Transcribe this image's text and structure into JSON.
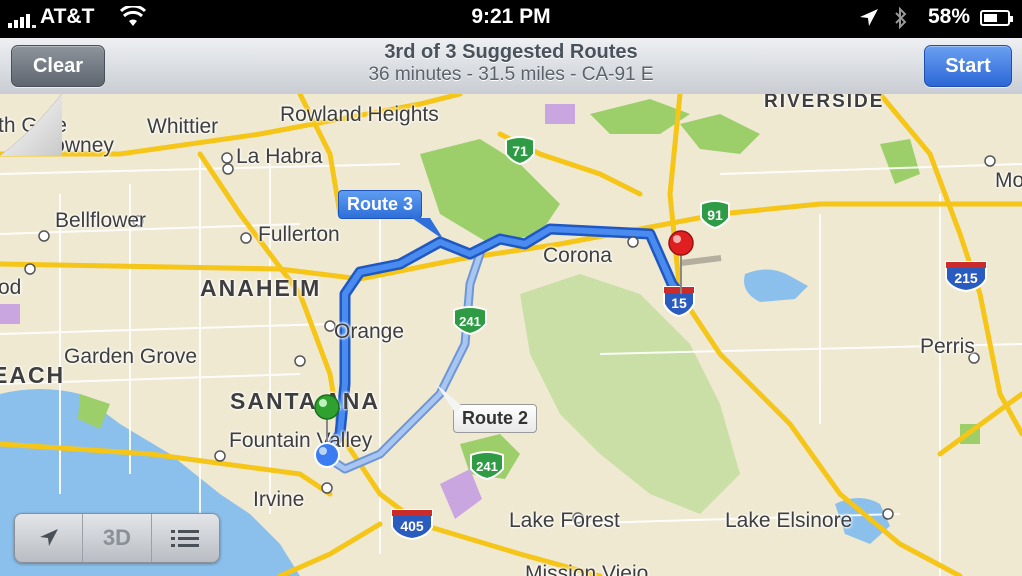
{
  "status_bar": {
    "carrier": "AT&T",
    "time": "9:21 PM",
    "battery_percent": "58%",
    "battery_level": 0.58,
    "icons": [
      "signal-bars-icon",
      "wifi-icon",
      "location-arrow-icon",
      "bluetooth-icon",
      "battery-icon"
    ]
  },
  "nav_bar": {
    "clear_label": "Clear",
    "start_label": "Start",
    "title": "3rd of 3 Suggested Routes",
    "subtitle": "36 minutes - 31.5 miles - CA-91 E",
    "start_color": "#2c67d6"
  },
  "map": {
    "places": {
      "riverside": "RIVERSIDE",
      "gate": "th Gate",
      "whittier": "Whittier",
      "rowland_heights": "Rowland Heights",
      "downey": "Downey",
      "la_habra": "La Habra",
      "bellflower": "Bellflower",
      "fullerton": "Fullerton",
      "corona": "Corona",
      "anaheim": "ANAHEIM",
      "od": "od",
      "orange": "Orange",
      "garden_grove": "Garden Grove",
      "each": "EACH",
      "santa_ana": "SANTA ANA",
      "fountain_valley": "Fountain Valley",
      "irvine": "Irvine",
      "lake_forest": "Lake Forest",
      "lake_elsinore": "Lake Elsinore",
      "perris": "Perris",
      "mo": "Mo",
      "mission_viejo": "Mission Viejo"
    },
    "shields": {
      "ca71": "71",
      "ca91": "91",
      "i215": "215",
      "i15": "15",
      "ca241a": "241",
      "ca241b": "241",
      "i405": "405"
    },
    "callouts": {
      "route3": "Route 3",
      "route2": "Route 2"
    },
    "colors": {
      "selected_route": "#2f73e6",
      "alt_route": "#8fb4ea",
      "freeway": "#f5c518",
      "park": "#9ccf6a",
      "water": "#8cc0ec"
    }
  },
  "toolbar": {
    "locate_icon": "location-arrow-icon",
    "threed_label": "3D",
    "list_icon": "list-icon"
  }
}
